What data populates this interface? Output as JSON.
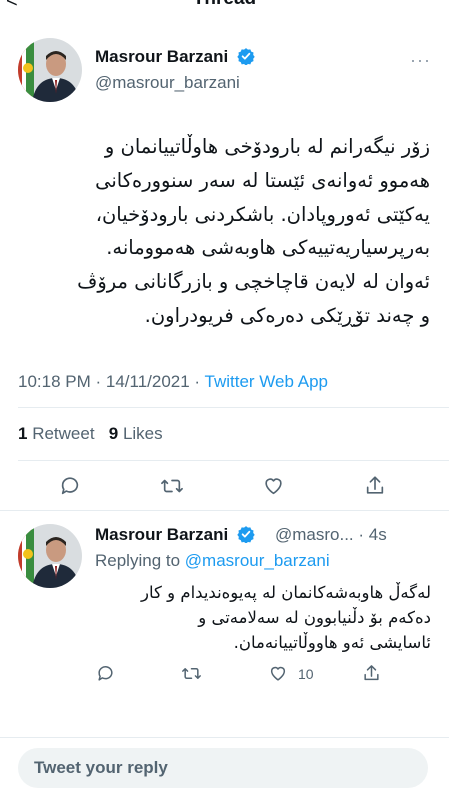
{
  "header": {
    "title": "Thread",
    "back_glyph": "<"
  },
  "main_tweet": {
    "name": "Masrour Barzani",
    "handle": "@masrour_barzani",
    "text_lines": [
      "زۆر نیگەرانم لە بارودۆخی هاوڵاتییانمان و",
      "هەموو ئەوانەی ئێستا لە سەر سنوورەکانی",
      "یەکێتی ئەوروپادان. باشکردنی بارودۆخیان،",
      "بەرپرسیاریەتییەکی هاوبەشی هەموومانە.",
      "ئەوان لە لایەن قاچاخچی و بازرگانانی مرۆڤ",
      "و چەند تۆڕێکی دەرەکی فریودراون."
    ],
    "time": "10:18 PM · 14/11/2021",
    "separator": " · ",
    "app": "Twitter Web App",
    "retweets": "1",
    "retweets_label": "Retweet",
    "likes": "9",
    "likes_label": "Likes"
  },
  "reply_tweet": {
    "name": "Masrour Barzani",
    "handle_time": "@masro... · 4s",
    "replying_prefix": "Replying to",
    "replying_to": "@masrour_barzani",
    "text_lines": [
      "لەگەڵ هاوبەشەکانمان لە پەیوەندیدام و کار",
      "دەکەم بۆ دڵنیابوون لە سەلامەتی و",
      "ئاسایشی ئەو هاووڵاتییانەمان."
    ],
    "like_count": "10"
  },
  "composer": {
    "placeholder": "Tweet your reply"
  },
  "colors": {
    "accent": "#1d9bf0",
    "muted": "#536471",
    "text": "#0f1419"
  },
  "icons": [
    "back-arrow-icon",
    "verified-badge-icon",
    "more-icon",
    "reply-icon",
    "retweet-icon",
    "like-icon",
    "share-icon"
  ]
}
